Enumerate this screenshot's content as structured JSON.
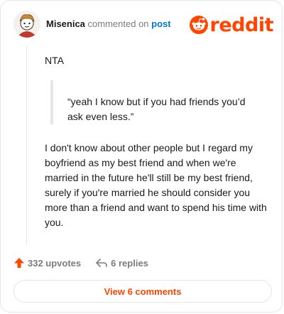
{
  "header": {
    "username": "Misenica",
    "action_text": "commented on",
    "post_link": "post",
    "brand": "reddit"
  },
  "comment": {
    "intro": "NTA",
    "quote": "“yeah I know but if you had friends you’d ask even less.”",
    "paragraph": "I don't know about other people but I regard my boyfriend as my best friend and when we're married in the future he'll still be my best friend, surely if you're married he should consider you more than a friend and want to spend his time with you."
  },
  "actions": {
    "upvotes": "332 upvotes",
    "replies": "6 replies"
  },
  "footer": {
    "view_comments": "View 6 comments"
  },
  "colors": {
    "brand": "#ff4500",
    "link": "#0079d3",
    "muted": "#7c7c7c",
    "text": "#1a1a1b",
    "border": "#e6e6e6"
  },
  "icons": {
    "avatar": "snoo-avatar",
    "logo": "reddit-snoo-icon",
    "upvote": "upvote-arrow-icon",
    "reply": "reply-arrow-icon"
  }
}
